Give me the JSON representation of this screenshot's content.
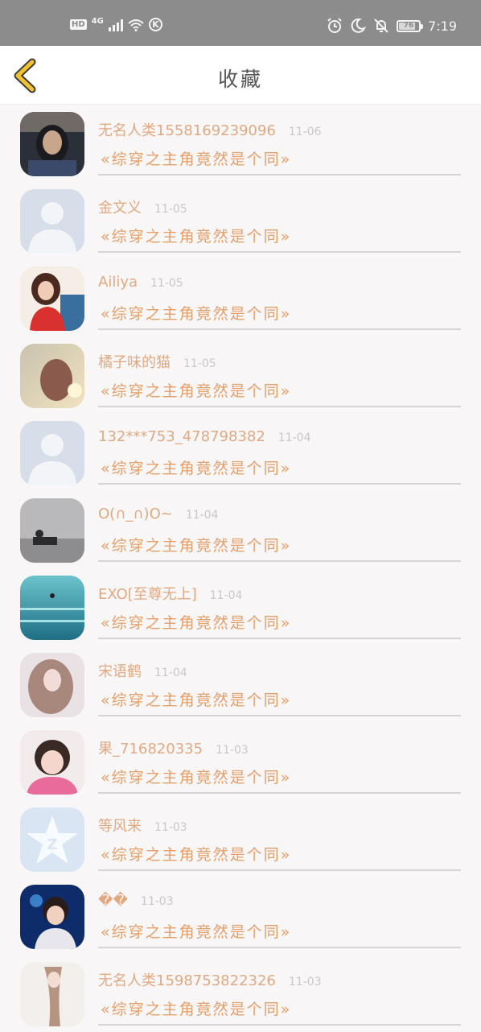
{
  "status": {
    "hd": "HD",
    "network": "4G",
    "k_icon": "K",
    "battery": "76",
    "battery_level": 0.76,
    "time": "7:19"
  },
  "header": {
    "title": "收藏",
    "back_icon": "chevron-left-icon"
  },
  "items": [
    {
      "user": "无名人类1558169239096",
      "date": "11-06",
      "book": "«综穿之主角竟然是个同»",
      "avatar": "photo-dark-hair"
    },
    {
      "user": "金文义",
      "date": "11-05",
      "book": "«综穿之主角竟然是个同»",
      "avatar": "default-silhouette"
    },
    {
      "user": "Ailiya",
      "date": "11-05",
      "book": "«综穿之主角竟然是个同»",
      "avatar": "photo-girl-red"
    },
    {
      "user": "橘子味的猫",
      "date": "11-05",
      "book": "«综穿之主角竟然是个同»",
      "avatar": "photo-sunset"
    },
    {
      "user": "132***753_478798382",
      "date": "11-04",
      "book": "«综穿之主角竟然是个同»",
      "avatar": "default-silhouette"
    },
    {
      "user": "O(∩_∩)O~",
      "date": "11-04",
      "book": "«综穿之主角竟然是个同»",
      "avatar": "photo-room"
    },
    {
      "user": "EXO[至尊无上]",
      "date": "11-04",
      "book": "«综穿之主角竟然是个同»",
      "avatar": "photo-ocean"
    },
    {
      "user": "宋语鹤",
      "date": "11-04",
      "book": "«综穿之主角竟然是个同»",
      "avatar": "photo-curly-hair"
    },
    {
      "user": "果_716820335",
      "date": "11-03",
      "book": "«综穿之主角竟然是个同»",
      "avatar": "photo-girl-pink"
    },
    {
      "user": "等风来",
      "date": "11-03",
      "book": "«综穿之主角竟然是个同»",
      "avatar": "qq-star"
    },
    {
      "user": "��",
      "date": "11-03",
      "book": "«综穿之主角竟然是个同»",
      "avatar": "photo-boy-stage"
    },
    {
      "user": "无名人类1598753822326",
      "date": "11-03",
      "book": "«综穿之主角竟然是个同»",
      "avatar": "photo-illustration"
    }
  ],
  "colors": {
    "accent_back": "#f2c130",
    "username": "#e0a982",
    "book": "#e59f6a",
    "date": "#c8c8c8",
    "statusbar": "#8c8c8c"
  }
}
